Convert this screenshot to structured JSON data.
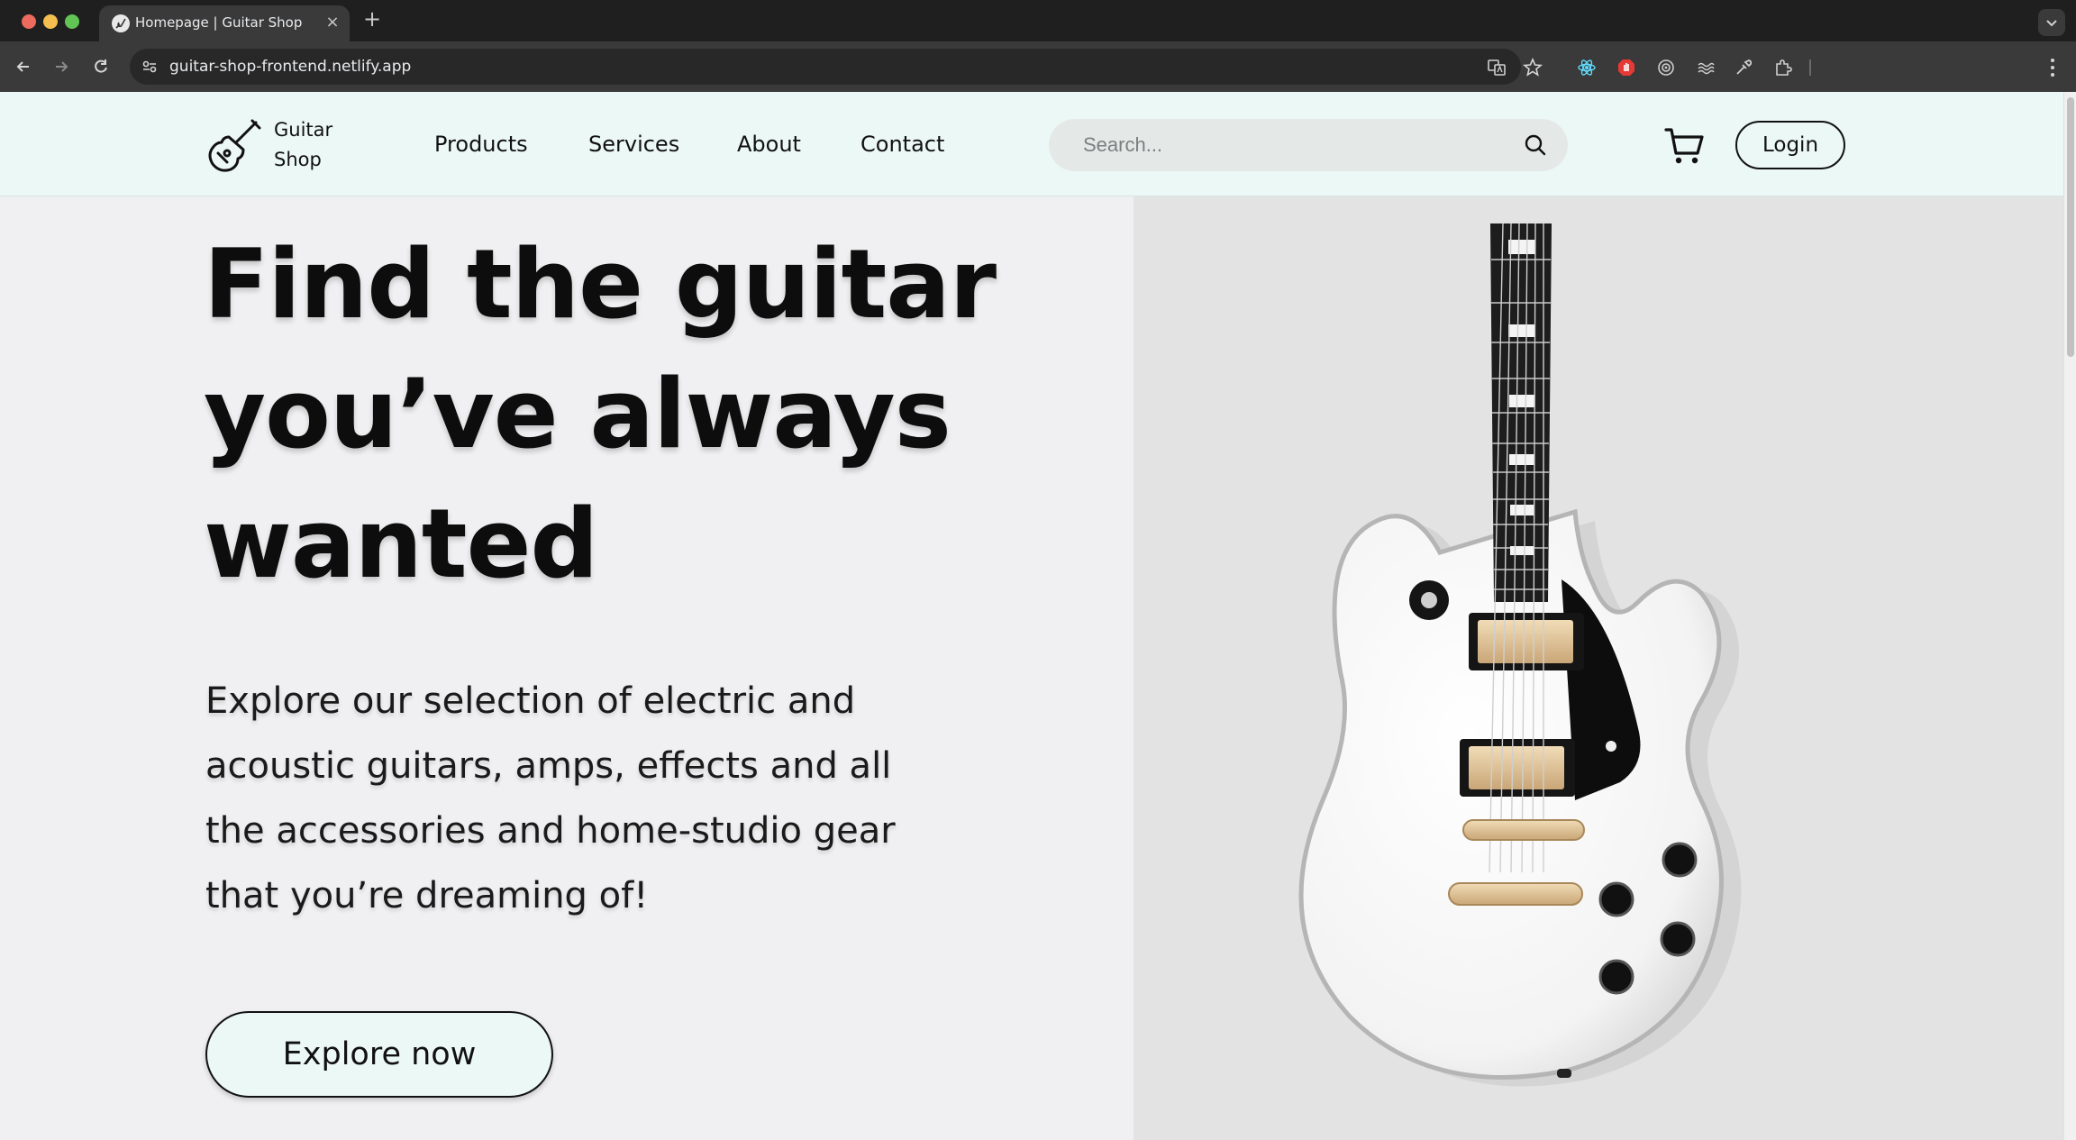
{
  "browser": {
    "tab_title": "Homepage | Guitar Shop",
    "tab_close": "×",
    "new_tab": "+",
    "url": "guitar-shop-frontend.netlify.app"
  },
  "header": {
    "brand_line1": "Guitar",
    "brand_line2": "Shop",
    "nav": [
      "Products",
      "Services",
      "About",
      "Contact"
    ],
    "search_placeholder": "Search...",
    "login_label": "Login",
    "accent_color": "#ecf8f6"
  },
  "hero": {
    "title_lines": [
      "Find the guitar",
      "you’ve always",
      "wanted"
    ],
    "text_lines": [
      "Explore our selection of electric and",
      "acoustic guitars, amps, effects and all",
      "the accessories and home-studio gear",
      "that you’re dreaming of!"
    ],
    "cta_label": "Explore now",
    "image": "white-electric-guitar"
  }
}
